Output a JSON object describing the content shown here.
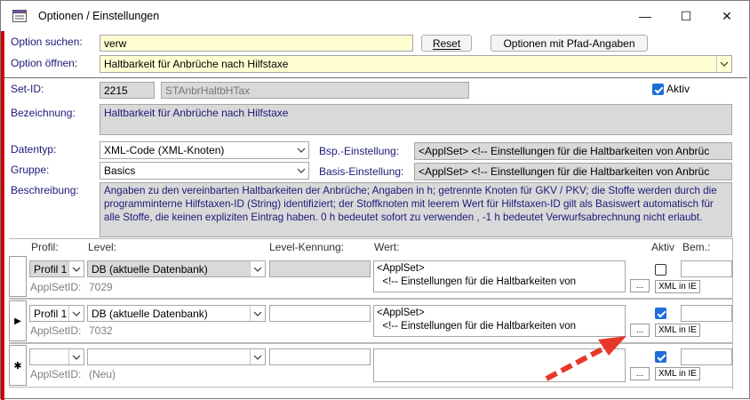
{
  "window": {
    "title": "Optionen / Einstellungen",
    "controls": {
      "minimize": "—",
      "maximize": "☐",
      "close": "✕"
    }
  },
  "search": {
    "label": "Option suchen:",
    "value": "verw",
    "reset_label": "Reset",
    "path_button_label": "Optionen mit Pfad-Angaben"
  },
  "open": {
    "label": "Option öffnen:",
    "value": "Haltbarkeit für Anbrüche nach Hilfstaxe"
  },
  "detail": {
    "set_id_label": "Set-ID:",
    "set_id_value": "2215",
    "set_key_value": "STAnbrHaltbHTax",
    "aktiv_label": "Aktiv",
    "bezeichnung_label": "Bezeichnung:",
    "bezeichnung_value": "Haltbarkeit für Anbrüche nach Hilfstaxe",
    "datentyp_label": "Datentyp:",
    "datentyp_value": "XML-Code (XML-Knoten)",
    "gruppe_label": "Gruppe:",
    "gruppe_value": "Basics",
    "bsp_label": "Bsp.-Einstellung:",
    "bsp_value": "<ApplSet>   <!-- Einstellungen für die Haltbarkeiten von Anbrüc",
    "basis_label": "Basis-Einstellung:",
    "basis_value": "<ApplSet>   <!-- Einstellungen für die Haltbarkeiten von Anbrüc",
    "beschreibung_label": "Beschreibung:",
    "beschreibung_value": "Angaben zu den vereinbarten Haltbarkeiten der Anbrüche; Angaben in h; getrennte Knoten für GKV / PKV; die Stoffe werden durch die programminterne Hilfstaxen-ID (String) identifiziert; der Stoffknoten mit leerem Wert für Hilfstaxen-ID gilt als Basiswert automatisch für alle Stoffe, die keinen expliziten Eintrag haben. 0 h bedeutet sofort zu verwenden , -1 h bedeutet Verwurfsabrechnung nicht erlaubt."
  },
  "grid": {
    "headers": {
      "profil": "Profil:",
      "level": "Level:",
      "kennung": "Level-Kennung:",
      "wert": "Wert:",
      "aktiv": "Aktiv",
      "bem": "Bem.:"
    },
    "rows": [
      {
        "profil": "Profil 1",
        "level": "DB  (aktuelle Datenbank)",
        "kennung": "",
        "wert_line1": "<ApplSet>",
        "wert_line2": "  <!-- Einstellungen für die Haltbarkeiten von",
        "ellipsis": "...",
        "xml_button": "XML in IE",
        "applset_label": "ApplSetID:",
        "applset_value": "7029",
        "selector": ""
      },
      {
        "profil": "Profil 1",
        "level": "DB  (aktuelle Datenbank)",
        "kennung": "",
        "wert_line1": "<ApplSet>",
        "wert_line2": "  <!-- Einstellungen für die Haltbarkeiten von",
        "ellipsis": "...",
        "xml_button": "XML in IE",
        "applset_label": "ApplSetID:",
        "applset_value": "7032",
        "selector": "▶"
      },
      {
        "profil": "",
        "level": "",
        "kennung": "",
        "wert_line1": "",
        "wert_line2": "",
        "ellipsis": "...",
        "xml_button": "XML in IE",
        "applset_label": "ApplSetID:",
        "applset_value": "(Neu)",
        "selector": "✱"
      }
    ]
  },
  "colors": {
    "label": "#1a1a78",
    "highlight": "#fefed2",
    "disabled": "#d9d9d9",
    "check": "#1e6fd9",
    "arrow": "#e8382a"
  },
  "icons": {
    "app": "form-icon",
    "combo": "chevron-down-icon",
    "annotation": "red-dashed-arrow"
  }
}
